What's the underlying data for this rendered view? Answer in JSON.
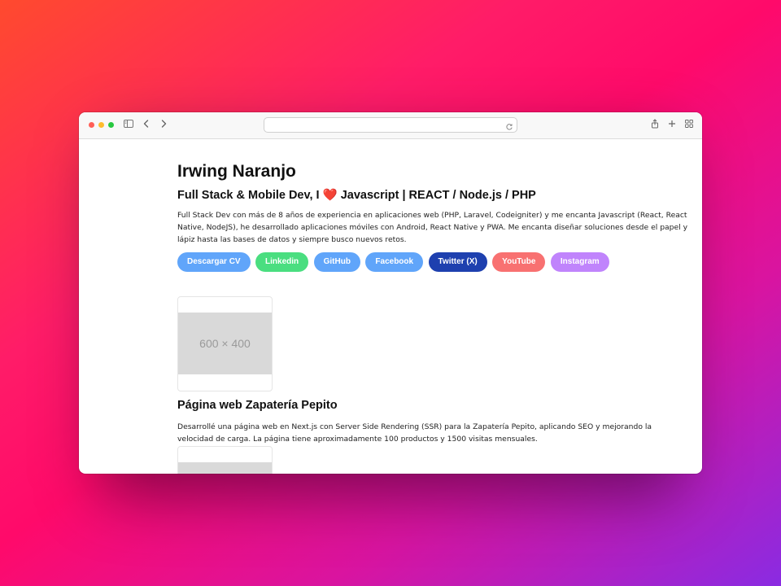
{
  "browser": {
    "url": "",
    "icons": [
      "sidebar-icon",
      "back-icon",
      "forward-icon",
      "reload-icon",
      "share-icon",
      "new-tab-icon",
      "tab-overview-icon"
    ]
  },
  "profile": {
    "name": "Irwing Naranjo",
    "role_prefix": "Full Stack & Mobile Dev, I ",
    "role_heart": "❤️",
    "role_suffix": " Javascript | REACT / Node.js / PHP",
    "bio": "Full Stack Dev con más de 8 años de experiencia en aplicaciones web (PHP, Laravel, Codeigniter) y me encanta Javascript (React, React Native, NodeJS), he desarrollado aplicaciones móviles con Android, React Native y PWA. Me encanta diseñar soluciones desde el papel y lápiz hasta las bases de datos y siempre busco nuevos retos."
  },
  "buttons": [
    {
      "label": "Descargar CV",
      "color": "#60a5fa"
    },
    {
      "label": "Linkedin",
      "color": "#4ade80"
    },
    {
      "label": "GitHub",
      "color": "#60a5fa"
    },
    {
      "label": "Facebook",
      "color": "#60a5fa"
    },
    {
      "label": "Twitter (X)",
      "color": "#1e40af"
    },
    {
      "label": "YouTube",
      "color": "#f87171"
    },
    {
      "label": "Instagram",
      "color": "#c084fc"
    }
  ],
  "projects": [
    {
      "image_placeholder": "600 × 400",
      "title": "Página web Zapatería Pepito",
      "description": "Desarrollé una página web en Next.js con Server Side Rendering (SSR) para la Zapatería Pepito, aplicando SEO y mejorando la velocidad de carga. La página tiene aproximadamente 100 productos y 1500 visitas mensuales."
    }
  ]
}
